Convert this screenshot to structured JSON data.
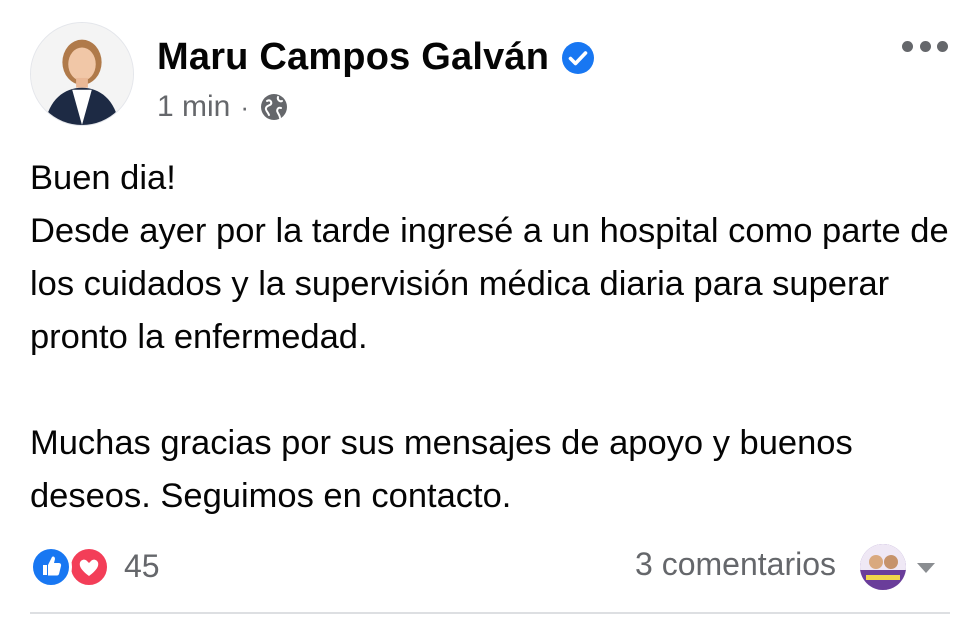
{
  "author": {
    "name": "Maru Campos Galván",
    "verified": true
  },
  "meta": {
    "time": "1 min",
    "separator": "·",
    "audience_icon": "globe-icon"
  },
  "post": {
    "paragraph_1": [
      "Buen dia!",
      "Desde ayer por la tarde ingresé a un hospital como parte de los cuidados y la supervisión médica diaria para superar pronto la enfermedad."
    ],
    "paragraph_2": "Muchas gracias por sus mensajes de apoyo y buenos deseos. Seguimos en contacto."
  },
  "footer": {
    "reaction_icons": [
      "like-icon",
      "love-icon"
    ],
    "reaction_count": "45",
    "comments": "3 comentarios"
  },
  "colors": {
    "facebook_blue": "#1877f2",
    "love_red": "#f33e58",
    "secondary_text": "#65676b",
    "divider": "#dddfe2"
  }
}
